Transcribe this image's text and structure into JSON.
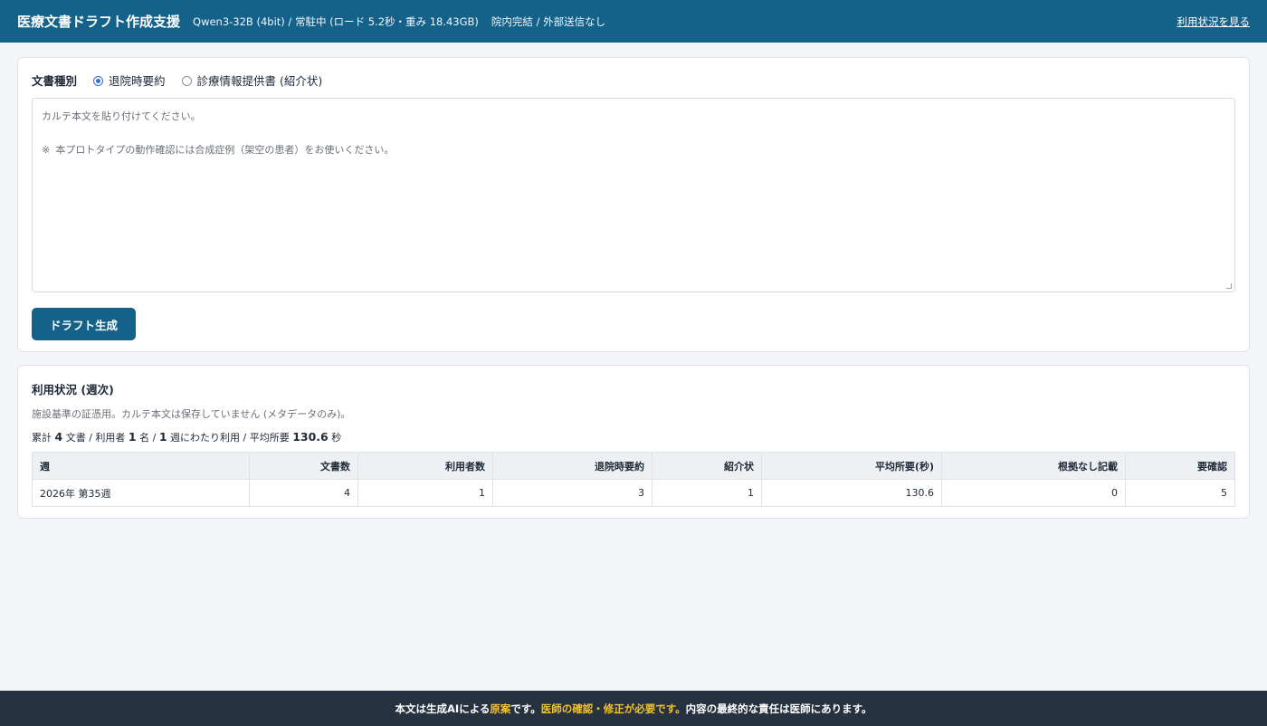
{
  "header": {
    "title": "医療文書ドラフト作成支援",
    "model_info": "Qwen3-32B (4bit) / 常駐中 (ロード 5.2秒・重み 18.43GB)",
    "privacy_info": "院内完結 / 外部送信なし",
    "usage_link": "利用状況を見る"
  },
  "doc_type": {
    "label": "文書種別",
    "options": [
      {
        "label": "退院時要約",
        "selected": true
      },
      {
        "label": "診療情報提供書 (紹介状)",
        "selected": false
      }
    ]
  },
  "karte": {
    "placeholder_line1": "カルテ本文を貼り付けてください。",
    "placeholder_line2": "",
    "placeholder_line3": "※  本プロトタイプの動作確認には合成症例（架空の患者）をお使いください。"
  },
  "generate_button": "ドラフト生成",
  "usage": {
    "title": "利用状況 (週次)",
    "note": "施設基準の証憑用。カルテ本文は保存していません (メタデータのみ)。",
    "summary": {
      "prefix": "累計",
      "docs": "4",
      "docs_unit": "文書 / 利用者",
      "users": "1",
      "users_unit": "名 /",
      "weeks": "1",
      "weeks_unit": "週にわたり利用 / 平均所要",
      "avg": "130.6",
      "avg_unit": "秒"
    },
    "columns": [
      "週",
      "文書数",
      "利用者数",
      "退院時要約",
      "紹介状",
      "平均所要(秒)",
      "根拠なし記載",
      "要確認"
    ],
    "rows": [
      [
        "2026年 第35週",
        "4",
        "1",
        "3",
        "1",
        "130.6",
        "0",
        "5"
      ]
    ]
  },
  "footer": {
    "part1": "本文は生成AIによる",
    "part2": "原案",
    "part3": "です。",
    "part4": "医師の確認・修正が必要です。",
    "part5": "内容の最終的な責任は医師にあります。"
  },
  "colors": {
    "primary": "#14618a",
    "footer_bg": "#273240",
    "highlight": "#f2c12e"
  }
}
